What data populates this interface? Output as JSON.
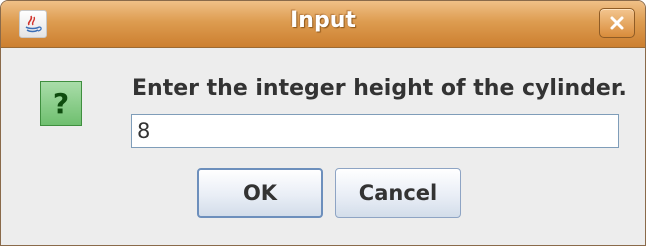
{
  "window": {
    "title": "Input",
    "app_icon": "java-icon",
    "close_icon": "close-icon"
  },
  "dialog": {
    "icon": "question-icon",
    "icon_glyph": "?",
    "message": "Enter the integer height of the cylinder.",
    "input_value": "8"
  },
  "buttons": {
    "ok_label": "OK",
    "cancel_label": "Cancel"
  },
  "colors": {
    "titlebar": "#dd9c50",
    "question_icon": "#8fd08f",
    "button_border": "#8ea4c4"
  }
}
